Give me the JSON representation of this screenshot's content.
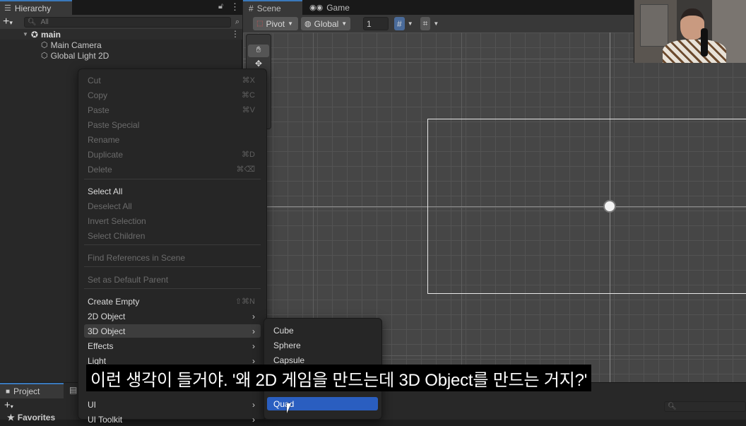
{
  "hierarchy": {
    "tab_label": "Hierarchy",
    "search_placeholder": "All",
    "scene_name": "main",
    "children": [
      "Main Camera",
      "Global Light 2D"
    ]
  },
  "scene_view": {
    "tabs": [
      "Scene",
      "Game"
    ],
    "toolbar": {
      "pivot": "Pivot",
      "global": "Global",
      "grid_snap_value": "1"
    }
  },
  "context_menu": {
    "items": [
      {
        "label": "Cut",
        "shortcut": "⌘X",
        "disabled": true
      },
      {
        "label": "Copy",
        "shortcut": "⌘C",
        "disabled": true
      },
      {
        "label": "Paste",
        "shortcut": "⌘V",
        "disabled": true
      },
      {
        "label": "Paste Special",
        "shortcut": "",
        "disabled": true
      },
      {
        "label": "Rename",
        "shortcut": "",
        "disabled": true
      },
      {
        "label": "Duplicate",
        "shortcut": "⌘D",
        "disabled": true
      },
      {
        "label": "Delete",
        "shortcut": "⌘⌫",
        "disabled": true
      },
      {
        "label": "Select All",
        "shortcut": "",
        "disabled": false
      },
      {
        "label": "Deselect All",
        "shortcut": "",
        "disabled": true
      },
      {
        "label": "Invert Selection",
        "shortcut": "",
        "disabled": true
      },
      {
        "label": "Select Children",
        "shortcut": "",
        "disabled": true
      },
      {
        "label": "Find References in Scene",
        "shortcut": "",
        "disabled": true
      },
      {
        "label": "Set as Default Parent",
        "shortcut": "",
        "disabled": true
      },
      {
        "label": "Create Empty",
        "shortcut": "⇧⌘N",
        "disabled": false
      },
      {
        "label": "2D Object",
        "submenu": true,
        "disabled": false
      },
      {
        "label": "3D Object",
        "submenu": true,
        "disabled": false
      },
      {
        "label": "Effects",
        "submenu": true,
        "disabled": false
      },
      {
        "label": "Light",
        "submenu": true,
        "disabled": false
      },
      {
        "label": "UI",
        "submenu": true,
        "disabled": false
      },
      {
        "label": "UI Toolkit",
        "submenu": true,
        "disabled": false
      }
    ]
  },
  "submenu_3d_object": {
    "items": [
      "Cube",
      "Sphere",
      "Capsule",
      "Quad"
    ],
    "selected": "Quad"
  },
  "bottom_panel": {
    "tab_label": "Project",
    "favorites_label": "Favorites"
  },
  "subtitle": "이런 생각이 들거야. '왜 2D 게임을 만드는데 3D Object를 만드는 거지?'",
  "colors": {
    "selection": "#2a5ec0",
    "tab_accent": "#3a79bb"
  }
}
